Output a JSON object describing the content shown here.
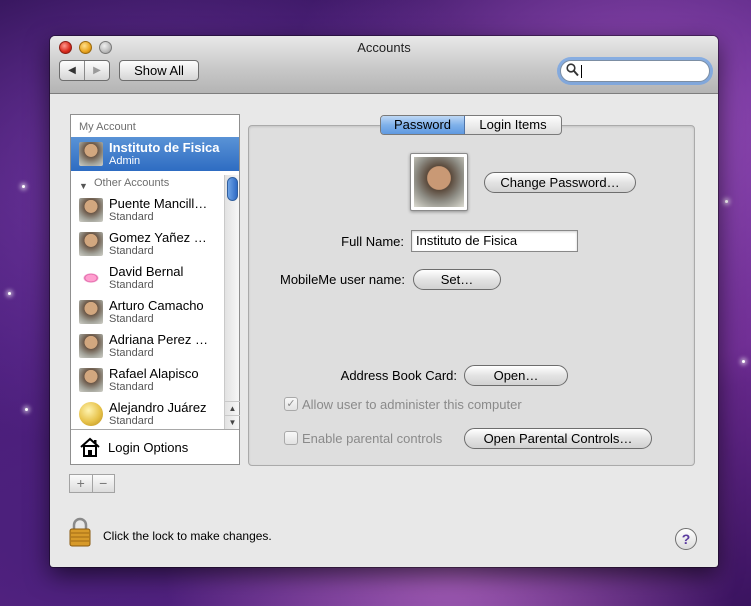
{
  "window": {
    "title": "Accounts"
  },
  "toolbar": {
    "back": "◀",
    "forward": "▶",
    "show_all": "Show All"
  },
  "search": {
    "value": ""
  },
  "sidebar": {
    "my_account_header": "My Account",
    "other_accounts_header": "Other Accounts",
    "my_account": {
      "name": "Instituto de Fisica",
      "role": "Admin"
    },
    "accounts": [
      {
        "name": "Puente Mancill…",
        "role": "Standard",
        "icon": "user-photo"
      },
      {
        "name": "Gomez Yañez …",
        "role": "Standard",
        "icon": "user-photo"
      },
      {
        "name": "David Bernal",
        "role": "Standard",
        "icon": "lips-picture"
      },
      {
        "name": "Arturo Camacho",
        "role": "Standard",
        "icon": "user-photo"
      },
      {
        "name": "Adriana Perez …",
        "role": "Standard",
        "icon": "user-photo"
      },
      {
        "name": "Rafael Alapisco",
        "role": "Standard",
        "icon": "user-photo"
      },
      {
        "name": "Alejandro Juárez",
        "role": "Standard",
        "icon": "tennis-ball-picture"
      }
    ],
    "login_options": "Login Options",
    "add": "+",
    "remove": "−"
  },
  "tabs": {
    "password": "Password",
    "login_items": "Login Items",
    "selected": "Password"
  },
  "password_panel": {
    "change_password": "Change Password…",
    "full_name_label": "Full Name:",
    "full_name_value": "Instituto de Fisica",
    "mobileme_label": "MobileMe user name:",
    "set": "Set…",
    "address_book_label": "Address Book Card:",
    "open": "Open…",
    "allow_admin": "Allow user to administer this computer",
    "allow_admin_checked": true,
    "parental_controls": "Enable parental controls",
    "parental_controls_checked": false,
    "open_parental": "Open Parental Controls…"
  },
  "footer": {
    "lock_text": "Click the lock to make changes.",
    "help": "?"
  },
  "colors": {
    "selection": "#2e6cc2",
    "focus_ring": "#6ea0e6",
    "tab_selected": "#7fb1ea"
  }
}
